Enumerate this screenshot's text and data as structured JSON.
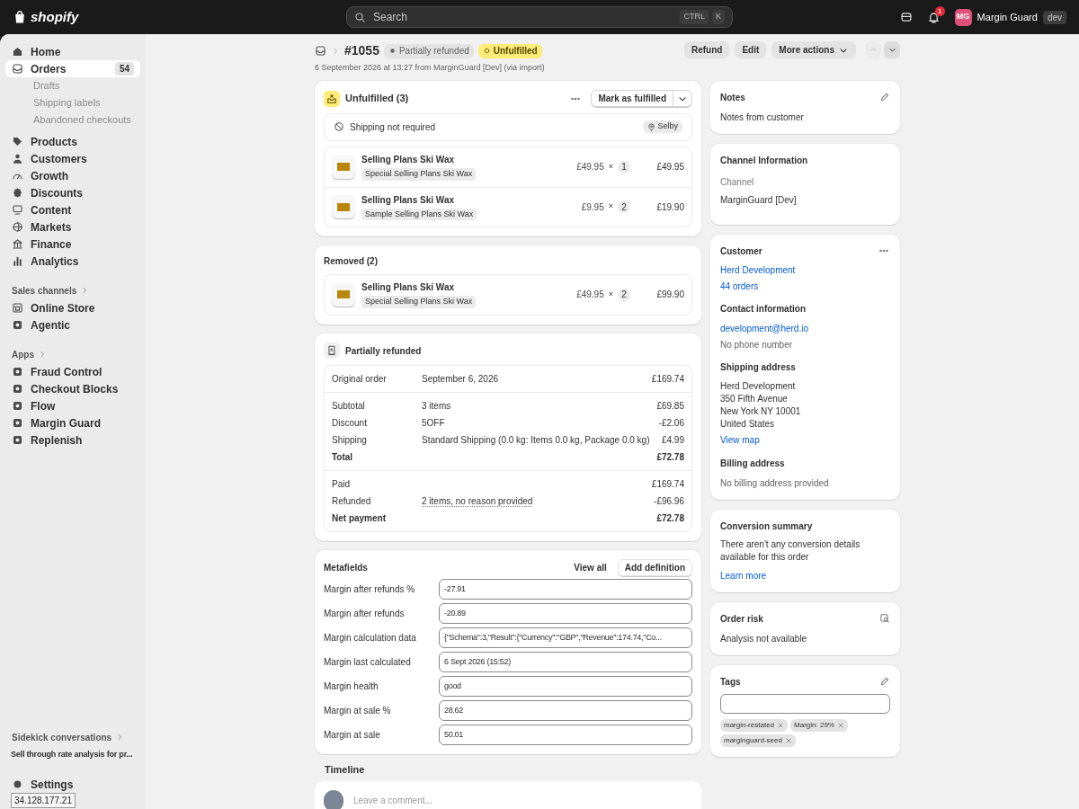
{
  "topbar": {
    "logo": "shopify",
    "search": {
      "placeholder": "Search",
      "shortcut": [
        "CTRL",
        "K"
      ]
    },
    "notification_count": "1",
    "user": {
      "initials": "MG",
      "name": "Margin Guard",
      "badge": "dev"
    }
  },
  "sidebar": {
    "groups": [
      {
        "items": [
          {
            "label": "Home",
            "selected": false
          },
          {
            "label": "Orders",
            "selected": true,
            "count": "54",
            "children": [
              {
                "label": "Drafts",
                "selected": false
              },
              {
                "label": "Shipping labels",
                "selected": false
              },
              {
                "label": "Abandoned checkouts",
                "selected": false
              }
            ]
          },
          {
            "label": "Products",
            "selected": false
          },
          {
            "label": "Customers",
            "selected": false
          },
          {
            "label": "Growth",
            "selected": false
          },
          {
            "label": "Discounts",
            "selected": false
          },
          {
            "label": "Content",
            "selected": false
          },
          {
            "label": "Markets",
            "selected": false
          },
          {
            "label": "Finance",
            "selected": false
          },
          {
            "label": "Analytics",
            "selected": false
          }
        ]
      },
      {
        "heading": "Sales channels",
        "items": [
          {
            "label": "Online Store",
            "selected": false
          },
          {
            "label": "Agentic",
            "selected": false
          }
        ]
      },
      {
        "heading": "Apps",
        "items": [
          {
            "label": "Fraud Control",
            "selected": false
          },
          {
            "label": "Checkout Blocks",
            "selected": false
          },
          {
            "label": "Flow",
            "selected": false
          },
          {
            "label": "Margin Guard",
            "selected": false
          },
          {
            "label": "Replenish",
            "selected": false
          }
        ]
      }
    ],
    "sidekick": {
      "heading": "Sidekick conversations",
      "items": [
        "Sell through rate analysis for pr..."
      ]
    },
    "settings": "Settings",
    "tooltip": "34.128.177.21"
  },
  "header": {
    "order": "#1055",
    "badges": [
      {
        "label": "Partially refunded",
        "kind": "refund"
      },
      {
        "label": "Unfulfilled",
        "kind": "unfulfilled"
      }
    ],
    "subtitle": "6 September 2026 at 13:27 from MarginGuard [Dev] (via import)",
    "actions": [
      "Refund",
      "Edit",
      "More actions"
    ],
    "nav": [
      {
        "kind": "up",
        "disabled": true
      },
      {
        "kind": "down",
        "disabled": false
      }
    ]
  },
  "unfulfilled": {
    "title": "Unfulfilled (3)",
    "primary_button": "Mark as fulfilled",
    "shipping": "Shipping not required",
    "location": "Selby",
    "items": [
      {
        "name": "Selling Plans Ski Wax",
        "variant": "Special Selling Plans Ski Wax",
        "price": "£49.95",
        "times": "×",
        "qty": "1",
        "total": "£49.95"
      },
      {
        "name": "Selling Plans Ski Wax",
        "variant": "Sample Selling Plans Ski Wax",
        "price": "£9.95",
        "times": "×",
        "qty": "2",
        "total": "£19.90"
      }
    ]
  },
  "removed": {
    "title": "Removed (2)",
    "items": [
      {
        "name": "Selling Plans Ski Wax",
        "variant": "Special Selling Plans Ski Wax",
        "price": "£49.95",
        "times": "×",
        "qty": "2",
        "total": "£99.90"
      }
    ]
  },
  "payment": {
    "title": "Partially refunded",
    "sections": [
      [
        {
          "label": "Original order",
          "detail": "September 6, 2026",
          "amount": "£169.74",
          "bold": false
        }
      ],
      [
        {
          "label": "Subtotal",
          "detail": "3 items",
          "amount": "£69.85",
          "bold": false
        },
        {
          "label": "Discount",
          "detail": "5OFF",
          "amount": "-£2.06",
          "bold": false
        },
        {
          "label": "Shipping",
          "detail": "Standard Shipping (0.0 kg: Items 0.0 kg, Package 0.0 kg)",
          "amount": "£4.99",
          "bold": false
        },
        {
          "label": "Total",
          "amount": "£72.78",
          "bold": true
        }
      ],
      [
        {
          "label": "Paid",
          "amount": "£169.74",
          "bold": false
        },
        {
          "label": "Refunded",
          "detail": "2 items, no reason provided",
          "detail_underlined": true,
          "amount": "-£96.96",
          "bold": false
        },
        {
          "label": "Net payment",
          "amount": "£72.78",
          "bold": true
        }
      ]
    ]
  },
  "metafields": {
    "title": "Metafields",
    "actions": [
      "View all",
      "Add definition"
    ],
    "fields": [
      {
        "label": "Margin after refunds %",
        "value": "-27.91"
      },
      {
        "label": "Margin after refunds",
        "value": "-20.89"
      },
      {
        "label": "Margin calculation data",
        "value": "{\"Schema\":3,\"Result\":{\"Currency\":\"GBP\",\"Revenue\":174.74,\"Co..."
      },
      {
        "label": "Margin last calculated",
        "value": "6 Sept 2026 (15:52)"
      },
      {
        "label": "Margin health",
        "value": "good"
      },
      {
        "label": "Margin at sale %",
        "value": "28.62"
      },
      {
        "label": "Margin at sale",
        "value": "50.01"
      }
    ]
  },
  "timeline": {
    "title": "Timeline",
    "placeholder": "Leave a comment..."
  },
  "notes": {
    "title": "Notes",
    "text": "Notes from customer"
  },
  "channel": {
    "title": "Channel Information",
    "label": "Channel",
    "value": "MarginGuard [Dev]"
  },
  "customer": {
    "title": "Customer",
    "name": "Herd Development",
    "orders": "44 orders",
    "contact_title": "Contact information",
    "email": "development@herd.io",
    "phone": "No phone number",
    "shipping_title": "Shipping address",
    "address": [
      "Herd Development",
      "350 Fifth Avenue",
      "New York NY 10001",
      "United States"
    ],
    "map_link": "View map",
    "billing_title": "Billing address",
    "billing": "No billing address provided"
  },
  "conversion": {
    "title": "Conversion summary",
    "text": "There aren't any conversion details available for this order",
    "link": "Learn more"
  },
  "risk": {
    "title": "Order risk",
    "text": "Analysis not available"
  },
  "tags": {
    "title": "Tags",
    "items": [
      "margin-restated",
      "Margin: 29%",
      "marginguard-seed"
    ]
  }
}
